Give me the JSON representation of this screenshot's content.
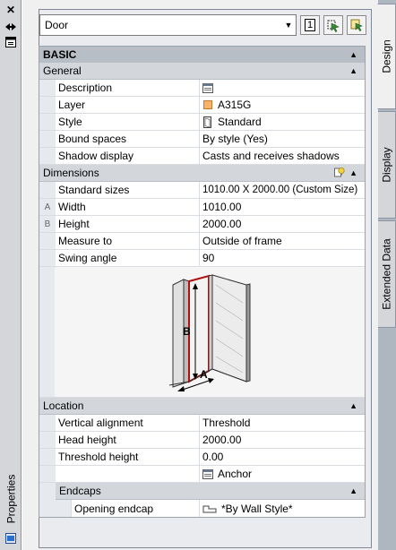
{
  "palette": {
    "title": "Properties",
    "close_icon": "close-icon",
    "autohide_icon": "autohide-icon",
    "menu_icon": "palette-menu-icon"
  },
  "toolbar": {
    "object_type": "Door",
    "quick_select_label": "1",
    "select_objects_icon": "select-objects-icon",
    "toggle_pickadd_icon": "pickadd-icon"
  },
  "tabs": [
    {
      "label": "Design",
      "active": true
    },
    {
      "label": "Display",
      "active": false
    },
    {
      "label": "Extended Data",
      "active": false
    }
  ],
  "grid": {
    "basic_header": "BASIC",
    "general": {
      "header": "General",
      "rows": [
        {
          "label": "Description",
          "value": "",
          "icon": "description-icon"
        },
        {
          "label": "Layer",
          "value": "A315G",
          "icon": "layer-color-swatch"
        },
        {
          "label": "Style",
          "value": "Standard",
          "icon": "door-style-icon"
        },
        {
          "label": "Bound spaces",
          "value": "By style (Yes)"
        },
        {
          "label": "Shadow display",
          "value": "Casts and receives shadows"
        }
      ]
    },
    "dimensions": {
      "header": "Dimensions",
      "rows": [
        {
          "label": "Standard sizes",
          "value": "1010.00  X  2000.00 (Custom Size)",
          "marker": ""
        },
        {
          "label": "Width",
          "value": "1010.00",
          "marker": "A"
        },
        {
          "label": "Height",
          "value": "2000.00",
          "marker": "B"
        },
        {
          "label": "Measure to",
          "value": "Outside of frame",
          "marker": ""
        },
        {
          "label": "Swing angle",
          "value": "90",
          "marker": ""
        }
      ],
      "illustration": {
        "label_a": "A",
        "label_b": "B"
      }
    },
    "location": {
      "header": "Location",
      "rows": [
        {
          "label": "Vertical alignment",
          "value": "Threshold"
        },
        {
          "label": "Head height",
          "value": "2000.00"
        },
        {
          "label": "Threshold height",
          "value": "0.00"
        },
        {
          "label": "",
          "value": "Anchor",
          "icon": "anchor-icon"
        }
      ],
      "endcaps": {
        "header": "Endcaps",
        "rows": [
          {
            "label": "Opening endcap",
            "value": "*By Wall Style*",
            "icon": "endcap-icon"
          }
        ]
      }
    }
  }
}
